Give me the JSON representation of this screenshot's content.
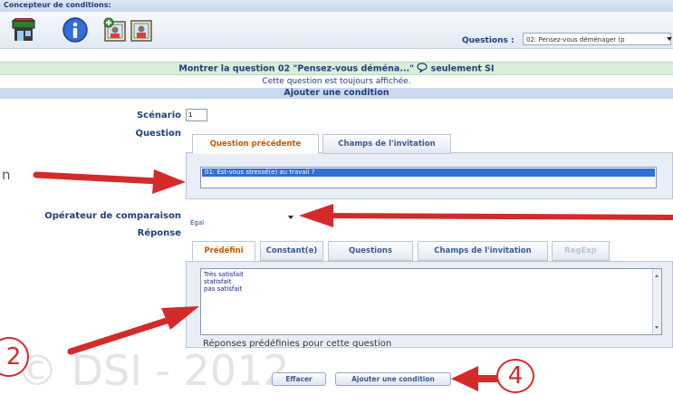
{
  "header": {
    "title": "Concepteur de conditions:"
  },
  "toolbar": {
    "icons": [
      "store-icon",
      "info-icon",
      "add-image-icon",
      "user-image-icon"
    ],
    "questions_label": "Questions :",
    "questions_selected": "02: Pensez-vous déménager (p"
  },
  "banner": {
    "title": "Montrer la question 02 \"Pensez-vous déména...\"",
    "title_suffix": "seulement SI",
    "subtitle": "Cette question est toujours affichée.",
    "section": "Ajouter une condition"
  },
  "form": {
    "scenario_label": "Scénario",
    "scenario_value": "1",
    "question_label": "Question",
    "question_tabs": [
      "Question précédente",
      "Champs de l'invitation"
    ],
    "question_list": [
      "01: Est-vous stressé(e) au travail ?"
    ],
    "operator_label": "Opérateur de comparaison",
    "operator_value": "Égal",
    "response_label": "Réponse",
    "response_tabs": [
      "Prédéfini",
      "Constant(e)",
      "Questions",
      "Champs de l'invitation",
      "RegExp"
    ],
    "response_options": [
      "Très satisfait",
      "statisfait",
      "pas satisfait"
    ],
    "response_help": "Réponses prédéfinies pour cette question",
    "clear_button": "Effacer",
    "add_button": "Ajouter une condition"
  },
  "annotations": {
    "step2": "2",
    "step4": "4",
    "left_letter": "n",
    "watermark": "© DSI - 2012"
  },
  "colors": {
    "arrow": "#d42a2a",
    "accent": "#1f3f7a",
    "highlight": "#2f6fd6"
  }
}
